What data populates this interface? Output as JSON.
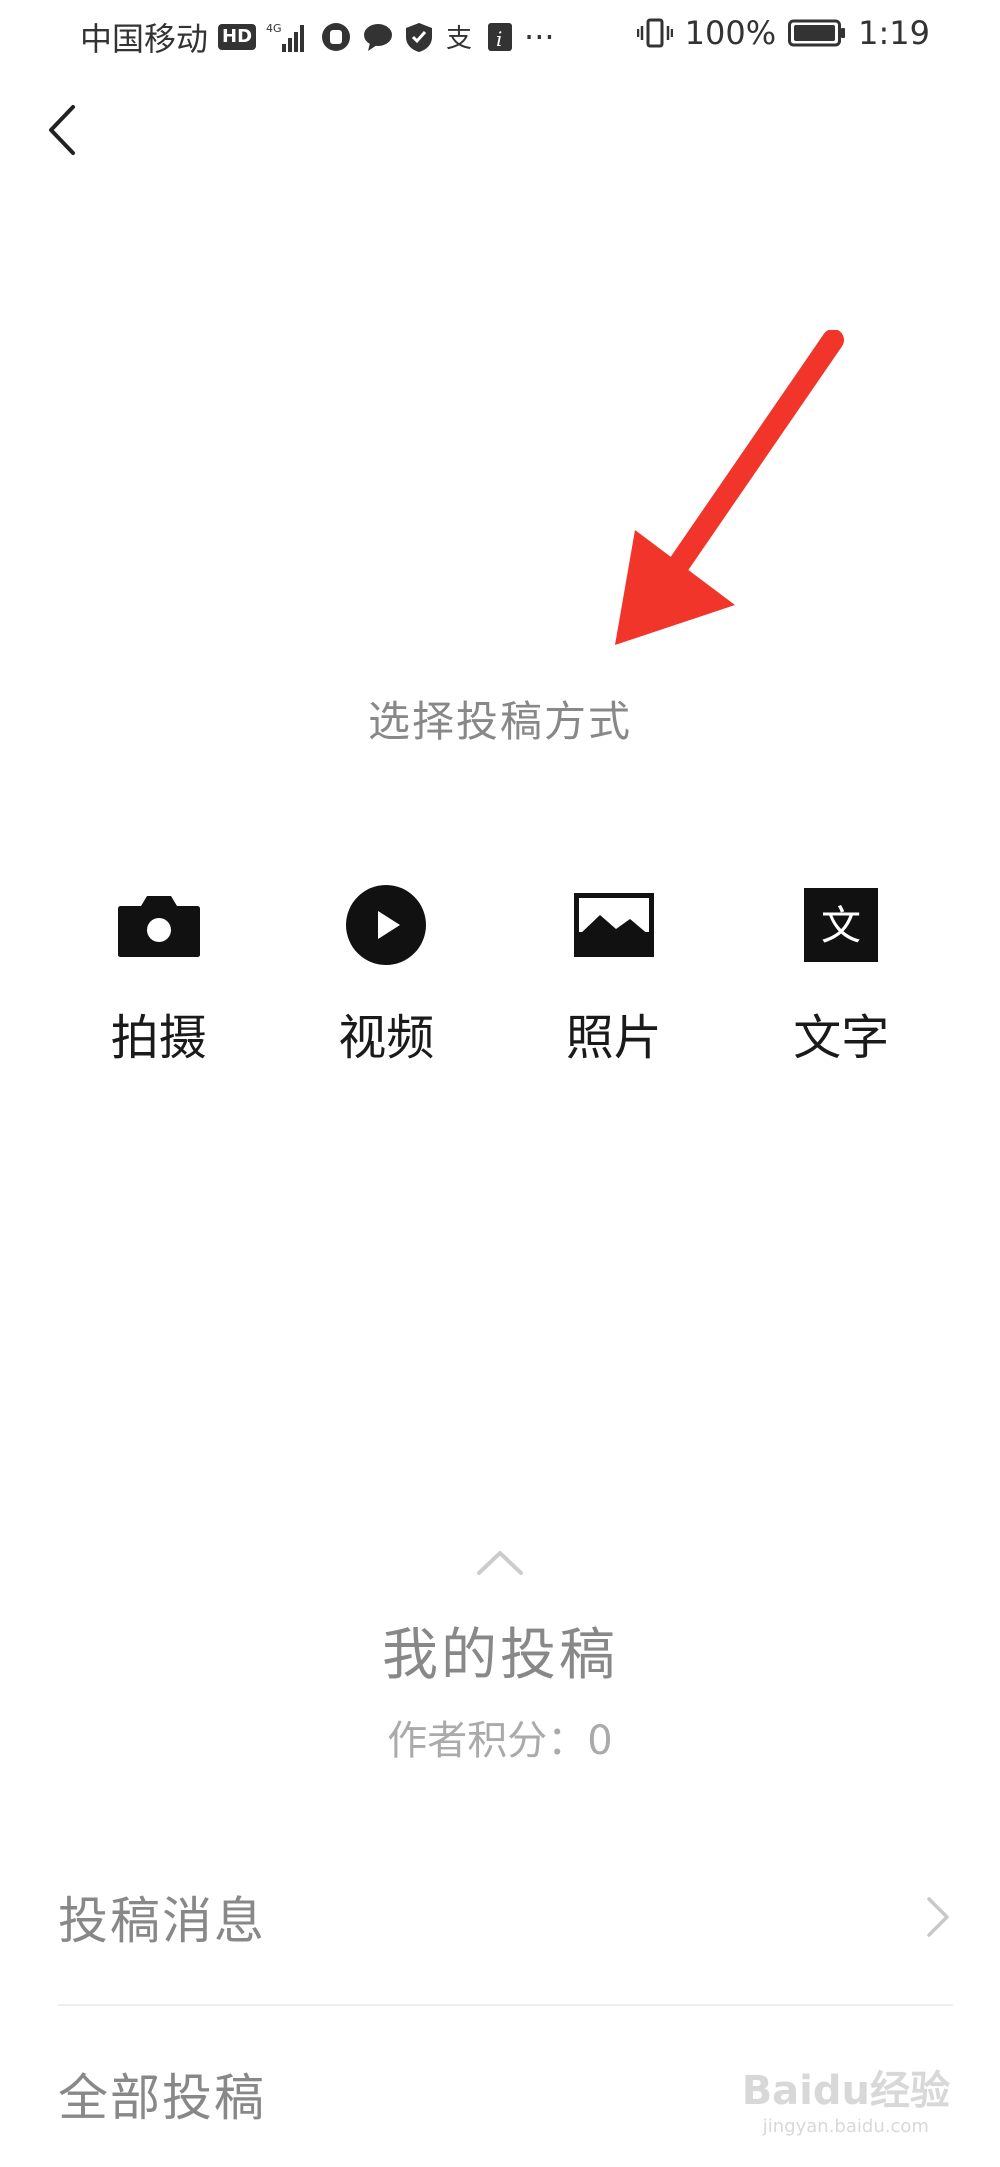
{
  "status_bar": {
    "carrier": "中国移动",
    "hd": "HD",
    "network": "4G",
    "battery": "100%",
    "time": "1:19",
    "more": "···",
    "icons": [
      "signal-icon",
      "app-icon",
      "chat-icon",
      "shield-icon",
      "alipay-icon",
      "info-icon",
      "vibrate-icon",
      "battery-icon"
    ]
  },
  "header": {
    "back_icon": "chevron-left-icon"
  },
  "main": {
    "choose_title": "选择投稿方式",
    "options": [
      {
        "label": "拍摄",
        "icon": "camera-icon"
      },
      {
        "label": "视频",
        "icon": "play-circle-icon"
      },
      {
        "label": "照片",
        "icon": "image-icon"
      },
      {
        "label": "文字",
        "icon": "text-icon",
        "glyph": "文"
      }
    ]
  },
  "my_submissions": {
    "title": "我的投稿",
    "score": "作者积分：0"
  },
  "list": [
    {
      "label": "投稿消息"
    },
    {
      "label": "全部投稿"
    }
  ],
  "watermark": {
    "main": "Baidu经验",
    "sub": "jingyan.baidu.com"
  },
  "colors": {
    "annotation": "#f2352a",
    "primary_text": "#1a1a1a",
    "muted_text": "#888888"
  }
}
